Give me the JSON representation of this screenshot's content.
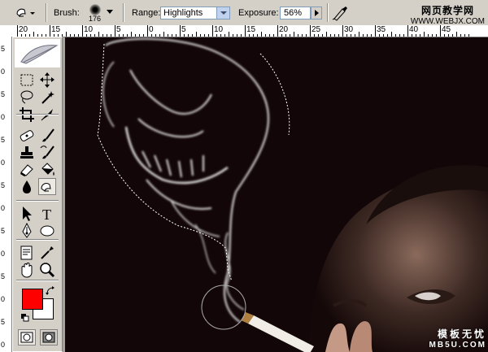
{
  "options_bar": {
    "brush_label": "Brush:",
    "brush_size": "176",
    "range_label": "Range:",
    "range_value": "Highlights",
    "exposure_label": "Exposure:",
    "exposure_value": "56%"
  },
  "watermark_top": {
    "text": "网页教学网",
    "url": "WWW.WEBJX.COM"
  },
  "watermark_bottom": {
    "text": "模板无忧",
    "url": "MB5U.COM"
  },
  "ruler": {
    "labels": [
      "20",
      "15",
      "10",
      "5",
      "0",
      "5",
      "10",
      "15",
      "20",
      "25",
      "30",
      "35",
      "40",
      "45"
    ]
  },
  "vruler": {
    "labels": [
      "5",
      "0",
      "5",
      "0",
      "5",
      "0",
      "5",
      "0",
      "5",
      "0",
      "5",
      "0",
      "5",
      "0"
    ]
  },
  "colors": {
    "foreground": "#ff0000",
    "background": "#ffffff"
  },
  "tools": [
    "marquee-icon",
    "move-icon",
    "lasso-icon",
    "magic-wand-icon",
    "crop-icon",
    "slice-icon",
    "healing-brush-icon",
    "brush-icon",
    "clone-stamp-icon",
    "history-brush-icon",
    "eraser-icon",
    "paint-bucket-icon",
    "blur-icon",
    "burn-icon",
    "path-select-icon",
    "type-icon",
    "pen-icon",
    "shape-icon",
    "notes-icon",
    "eyedropper-icon",
    "hand-icon",
    "zoom-icon"
  ]
}
